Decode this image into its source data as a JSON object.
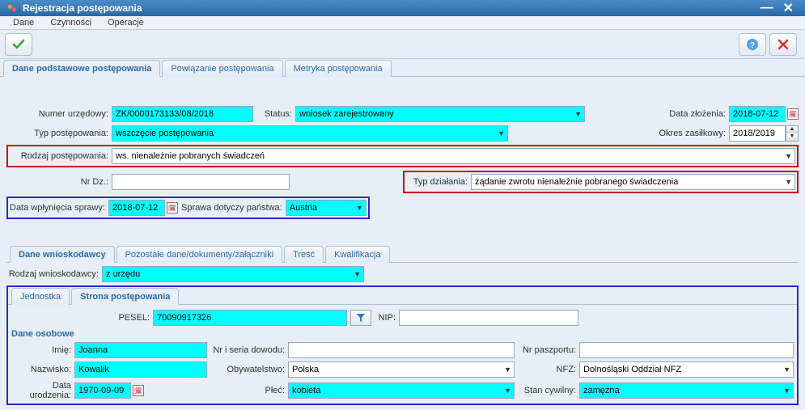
{
  "window": {
    "title": "Rejestracja postępowania"
  },
  "menu": {
    "dane": "Dane",
    "czynnosci": "Czynności",
    "operacje": "Operacje"
  },
  "tabs1": {
    "t1": "Dane podstawowe postępowania",
    "t2": "Powiązanie postępowania",
    "t3": "Metryka postępowania"
  },
  "labels": {
    "numer_urz": "Numer urzędowy:",
    "status": "Status:",
    "data_zloz": "Data złożenia:",
    "typ_post": "Typ postępowania:",
    "okres_zas": "Okres zasiłkowy:",
    "rodzaj_post": "Rodzaj postępowania:",
    "nr_dz": "Nr Dz.:",
    "typ_dzial": "Typ działania:",
    "data_wplyn": "Data wpłynięcia sprawy:",
    "sprawa_dot": "Sprawa dotyczy państwa:",
    "rodzaj_wn": "Rodzaj wnioskodawcy:",
    "pesel": "PESEL:",
    "nip": "NIP:",
    "dane_os": "Dane osobowe",
    "imie": "Imię:",
    "nrser": "Nr i seria dowodu:",
    "nrpasz": "Nr paszportu:",
    "nazwisko": "Nazwisko:",
    "obyw": "Obywatelstwo:",
    "nfz": "NFZ:",
    "data_ur": "Data urodzenia:",
    "plec": "Płeć:",
    "stan_cyw": "Stan cywilny:"
  },
  "values": {
    "numer_urz": "ZK/0000173133/08/2018",
    "status": "wniosek zarejestrowany",
    "data_zloz": "2018-07-12",
    "typ_post": "wszczęcie postępowania",
    "okres_zas": "2018/2019",
    "rodzaj_post": "ws. nienależnie pobranych świadczeń",
    "nr_dz": "",
    "typ_dzial": "żądanie zwrotu nienależnie pobranego świadczenia",
    "data_wplyn": "2018-07-12",
    "sprawa_dot": "Austria",
    "rodzaj_wn": "z urzędu",
    "pesel": "70090917326",
    "nip": "",
    "imie": "Joanna",
    "nrser": "",
    "nrpasz": "",
    "nazwisko": "Kowalik",
    "obyw": "Polska",
    "nfz": "Dolnośląski Oddział NFZ",
    "data_ur": "1970-09-09",
    "plec": "kobieta",
    "stan_cyw": "zamężna"
  },
  "tabs2": {
    "t1": "Dane wnioskodawcy",
    "t2": "Pozostałe dane/dokumenty/załączniki",
    "t3": "Treść",
    "t4": "Kwalifikacja"
  },
  "tabs3": {
    "t1": "Jednostka",
    "t2": "Strona postępowania"
  }
}
